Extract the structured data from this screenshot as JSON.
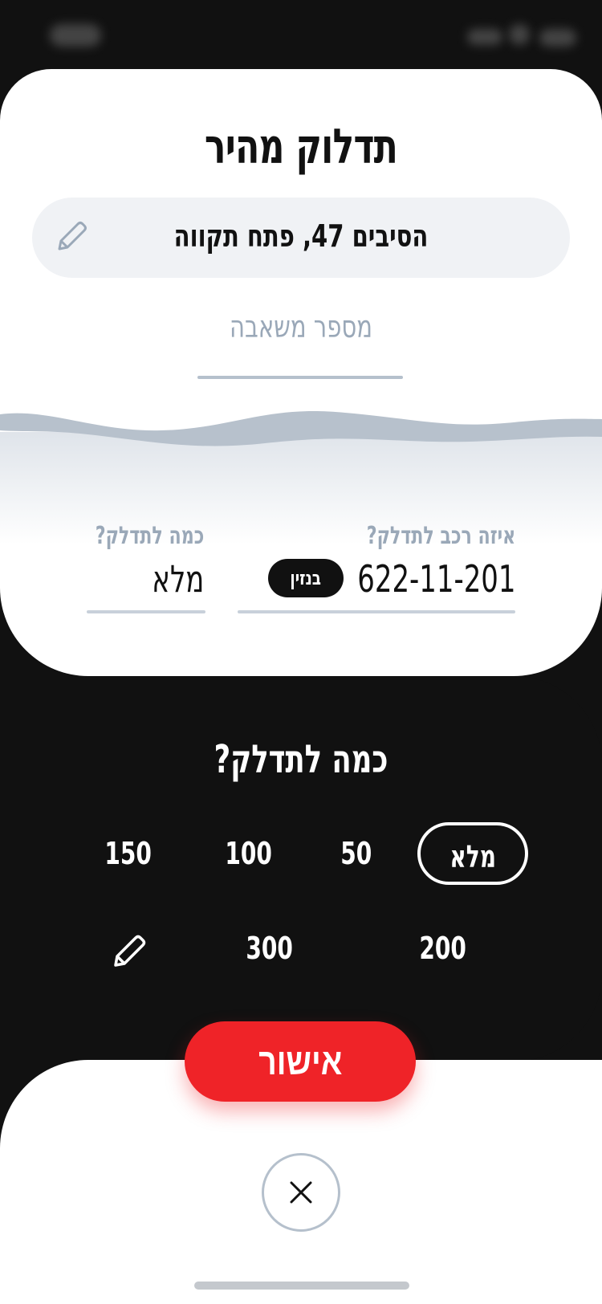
{
  "header": {
    "title": "תדלוק מהיר"
  },
  "location": {
    "address": "הסיבים 47, פתח תקווה",
    "pump_placeholder": "מספר משאבה"
  },
  "vehicle_field": {
    "label": "איזה רכב לתדלק?",
    "plate": "622-11-201",
    "fuel_badge": "בנזין"
  },
  "amount_field": {
    "label": "כמה לתדלק?",
    "value": "מלא"
  },
  "amount_picker": {
    "title": "כמה לתדלק?",
    "options": [
      "מלא",
      "50",
      "100",
      "150",
      "200",
      "300"
    ],
    "selected": "מלא"
  },
  "actions": {
    "confirm_label": "אישור"
  },
  "colors": {
    "accent": "#ef2328",
    "dark": "#111111",
    "muted": "#9aa8b8"
  }
}
